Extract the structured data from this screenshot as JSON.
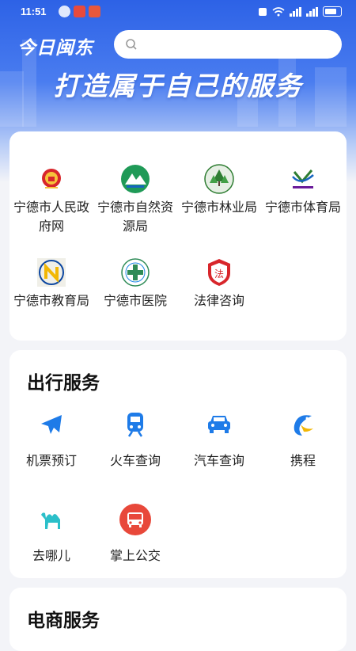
{
  "status_bar": {
    "time": "11:51"
  },
  "header": {
    "app_logo": "今日闽东",
    "search": {
      "placeholder": ""
    },
    "slogan": "打造属于自己的服务"
  },
  "gov_section": {
    "items": [
      {
        "label": "宁德市人民政府网",
        "icon": "national-emblem-icon"
      },
      {
        "label": "宁德市自然资源局",
        "icon": "natural-resources-logo-icon"
      },
      {
        "label": "宁德市林业局",
        "icon": "forestry-logo-icon"
      },
      {
        "label": "宁德市体育局",
        "icon": "sports-logo-icon"
      },
      {
        "label": "宁德市教育局",
        "icon": "education-logo-icon"
      },
      {
        "label": "宁德市医院",
        "icon": "hospital-logo-icon"
      },
      {
        "label": "法律咨询",
        "icon": "law-shield-icon"
      }
    ]
  },
  "travel_section": {
    "title": "出行服务",
    "items": [
      {
        "label": "机票预订",
        "icon": "airplane-icon"
      },
      {
        "label": "火车查询",
        "icon": "train-icon"
      },
      {
        "label": "汽车查询",
        "icon": "car-icon"
      },
      {
        "label": "携程",
        "icon": "ctrip-dolphin-icon"
      },
      {
        "label": "去哪儿",
        "icon": "qunar-camel-icon"
      },
      {
        "label": "掌上公交",
        "icon": "bus-icon"
      }
    ]
  },
  "ecommerce_section": {
    "title": "电商服务"
  },
  "colors": {
    "brand_blue": "#2d62e6",
    "icon_blue": "#1e7be8"
  }
}
